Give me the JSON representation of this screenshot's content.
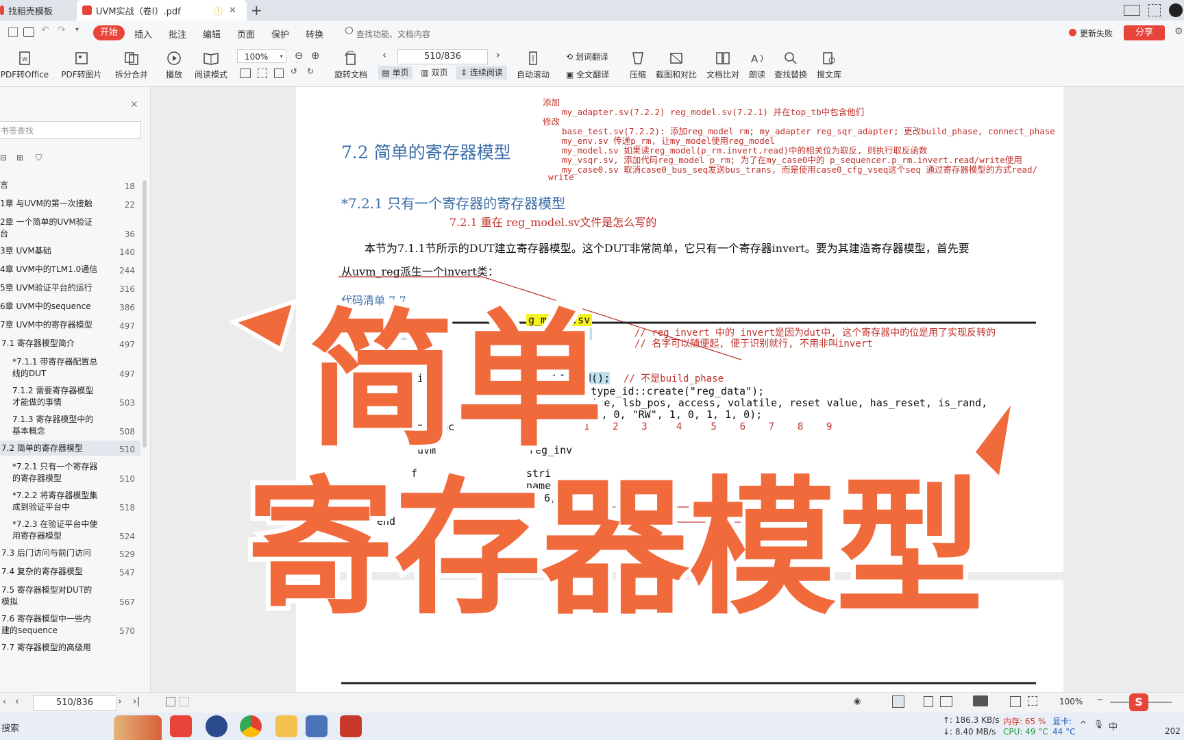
{
  "tabs": [
    {
      "label": "找稻壳模板",
      "active": false
    },
    {
      "label": "UVM实战（卷Ⅰ）.pdf",
      "active": true
    }
  ],
  "menu": {
    "start": "开始",
    "items": [
      "插入",
      "批注",
      "编辑",
      "页面",
      "保护",
      "转换"
    ],
    "search_placeholder": "查找功能、文档内容",
    "update_failed": "更新失败",
    "share": "分享"
  },
  "toolbar": {
    "pdf_to_office": "PDF转Office",
    "pdf_to_image": "PDF转图片",
    "split_merge": "拆分合并",
    "play": "播放",
    "read_mode": "阅读模式",
    "zoom": "100%",
    "rotate_doc": "旋转文档",
    "page_value": "510/836",
    "single_page": "单页",
    "double_page": "双页",
    "continuous": "连续阅读",
    "auto_scroll": "自动滚动",
    "word_translate": "划词翻译",
    "full_translate": "全文翻译",
    "compress": "压缩",
    "screenshot_compare": "截图和对比",
    "doc_compare": "文档比对",
    "read_aloud": "朗读",
    "find_replace": "查找替换",
    "search_lib": "搜文库"
  },
  "sidebar": {
    "search_placeholder": "书签查找",
    "toc": [
      {
        "label": "言",
        "page": "18"
      },
      {
        "label": "1章 与UVM的第一次接触",
        "page": "22"
      },
      {
        "label": "2章 一个简单的UVM验证\n台",
        "page": "36"
      },
      {
        "label": "3章 UVM基础",
        "page": "140"
      },
      {
        "label": "4章 UVM中的TLM1.0通信",
        "page": "244"
      },
      {
        "label": "5章 UVM验证平台的运行",
        "page": "316"
      },
      {
        "label": "6章 UVM中的sequence",
        "page": "386"
      },
      {
        "label": "7章 UVM中的寄存器模型",
        "page": "497"
      },
      {
        "label": "7.1 寄存器模型简介",
        "page": "497"
      },
      {
        "label": "*7.1.1 带寄存器配置总\n线的DUT",
        "page": "497"
      },
      {
        "label": "7.1.2 需要寄存器模型\n才能做的事情",
        "page": "503"
      },
      {
        "label": "7.1.3 寄存器模型中的\n基本概念",
        "page": "508"
      },
      {
        "label": "7.2 简单的寄存器模型",
        "page": "510"
      },
      {
        "label": "*7.2.1 只有一个寄存器\n的寄存器模型",
        "page": "510"
      },
      {
        "label": "*7.2.2 将寄存器模型集\n成到验证平台中",
        "page": "518"
      },
      {
        "label": "*7.2.3 在验证平台中使\n用寄存器模型",
        "page": "524"
      },
      {
        "label": "7.3 后门访问与前门访问",
        "page": "529"
      },
      {
        "label": "7.4 复杂的寄存器模型",
        "page": "547"
      },
      {
        "label": "7.5 寄存器模型对DUT的\n模拟",
        "page": "567"
      },
      {
        "label": "7.6 寄存器模型中一些内\n建的sequence",
        "page": "570"
      },
      {
        "label": "7.7 寄存器模型的高级用",
        "page": ""
      }
    ]
  },
  "document": {
    "notes": {
      "add_label": "添加",
      "add_line": "my_adapter.sv(7.2.2)    reg_model.sv(7.2.1) 并在top_tb中包含他们",
      "modify_label": "修改",
      "mod1": "base_test.sv(7.2.2): 添加reg_model rm; my_adapter reg_sqr_adapter; 更改build_phase, connect_phase",
      "mod2": "my_env.sv 传递p_rm, 让my_model使用reg_model",
      "mod3": "my_model.sv 如果读reg_model(p_rm.invert.read)中的相关位为取反, 则执行取反函数",
      "mod4": "my_vsqr.sv, 添加代码reg_model p_rm;  为了在my_case0中的 p_sequencer.p_rm.invert.read/write使用",
      "mod5": "my_case0.sv 取消case0_bus_seq发送bus_trans, 而是使用case0_cfg_vseq这个seq 通过寄存器模型的方式read/",
      "mod5b": "write"
    },
    "section_title": "7.2    简单的寄存器模型",
    "subsection_title": "*7.2.1    只有一个寄存器的寄存器模型",
    "red_note": "7.2.1 重在 reg_model.sv文件是怎么写的",
    "para1": "本节为7.1.1节所示的DUT建立寄存器模型。这个DUT非常简单，它只有一个寄存器invert。要为其建造寄存器模型，首先要",
    "para2": "从uvm_reg派生一个invert类：",
    "listing": "代码清单    7-7",
    "code_path": "src/c",
    "code_file": "g_model.sv",
    "code_class": "class",
    "code_extends": "s uvm_reg;",
    "comment1": "// reg_invert 中的 invert是因为dut中, 这个寄存器中的位是用了实现反转的",
    "comment2": "// 名字可以随便起, 便于识别就行, 不用非叫invert",
    "code_reg": "eg_data;",
    "code_build": "build();",
    "comment3": "// 不是build_phase",
    "code_create": "eg_field::type_id::create(\"reg_data\");",
    "code_params": "parent, size, lsb_pos, access, volatile, reset value, has_reset, is_rand,",
    "code_configure": "nfigure(this, 1, 0, \"RW\", 1, 0, 1, 1, 0);",
    "code_endfunc": "endfunc",
    "param_numbers": "1    2    3     4     5    6    7    8    9",
    "code_uvm": "`uvm",
    "code_reg_inv": "reg_inv",
    "code_f": "f",
    "code_stri": "stri",
    "code_name": "name,",
    "code_six": "6,",
    "code_end": "end",
    "code_r": "r",
    "code_vi": "vi",
    "code_d": "d",
    "code_s": "s",
    "overlay_line1": "简单",
    "overlay_line2": "寄存器模型"
  },
  "statusbar": {
    "page_value": "510/836",
    "zoom": "100%"
  },
  "taskbar": {
    "search": "搜索",
    "net_up": "↑: 186.3 KB/s",
    "net_down": "↓: 8.40 MB/s",
    "mem": "内存: 65 %",
    "cpu": "CPU: 49 °C",
    "gpu_label": "显卡:",
    "gpu_temp": "44 °C",
    "ime": "中",
    "clock": "202"
  },
  "colors": {
    "accent_red": "#e8443a",
    "overlay_fill": "#f06a3c",
    "title_blue": "#3b6ea8",
    "note_red": "#c0302a"
  }
}
